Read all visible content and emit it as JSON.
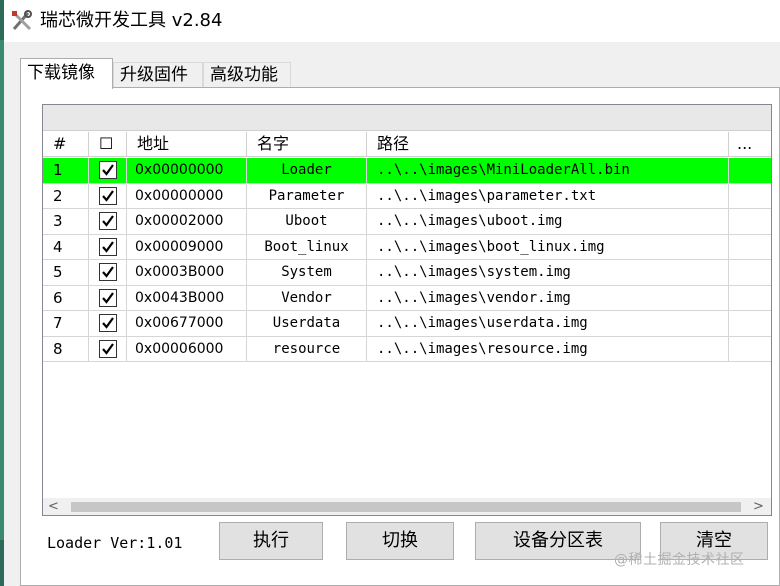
{
  "window": {
    "title": "瑞芯微开发工具 v2.84",
    "icon": "tools-icon"
  },
  "tabs": [
    {
      "label": "下载镜像",
      "active": true
    },
    {
      "label": "升级固件",
      "active": false
    },
    {
      "label": "高级功能",
      "active": false
    }
  ],
  "table": {
    "headers": {
      "index": "#",
      "check": "☐",
      "address": "地址",
      "name": "名字",
      "path": "路径",
      "more": "..."
    },
    "rows": [
      {
        "index": "1",
        "checked": true,
        "address": "0x00000000",
        "name": "Loader",
        "path": "..\\..\\images\\MiniLoaderAll.bin",
        "selected": true
      },
      {
        "index": "2",
        "checked": true,
        "address": "0x00000000",
        "name": "Parameter",
        "path": "..\\..\\images\\parameter.txt",
        "selected": false
      },
      {
        "index": "3",
        "checked": true,
        "address": "0x00002000",
        "name": "Uboot",
        "path": "..\\..\\images\\uboot.img",
        "selected": false
      },
      {
        "index": "4",
        "checked": true,
        "address": "0x00009000",
        "name": "Boot_linux",
        "path": "..\\..\\images\\boot_linux.img",
        "selected": false
      },
      {
        "index": "5",
        "checked": true,
        "address": "0x0003B000",
        "name": "System",
        "path": "..\\..\\images\\system.img",
        "selected": false
      },
      {
        "index": "6",
        "checked": true,
        "address": "0x0043B000",
        "name": "Vendor",
        "path": "..\\..\\images\\vendor.img",
        "selected": false
      },
      {
        "index": "7",
        "checked": true,
        "address": "0x00677000",
        "name": "Userdata",
        "path": "..\\..\\images\\userdata.img",
        "selected": false
      },
      {
        "index": "8",
        "checked": true,
        "address": "0x00006000",
        "name": "resource",
        "path": "..\\..\\images\\resource.img",
        "selected": false
      }
    ],
    "selected_color": "#00ff00"
  },
  "scrollbar": {
    "left_arrow": "<",
    "right_arrow": ">"
  },
  "footer": {
    "loader_version": "Loader Ver:1.01",
    "buttons": {
      "run": "执行",
      "switch": "切换",
      "partition_table": "设备分区表",
      "clear": "清空"
    }
  },
  "watermark": "@稀土掘金技术社区"
}
